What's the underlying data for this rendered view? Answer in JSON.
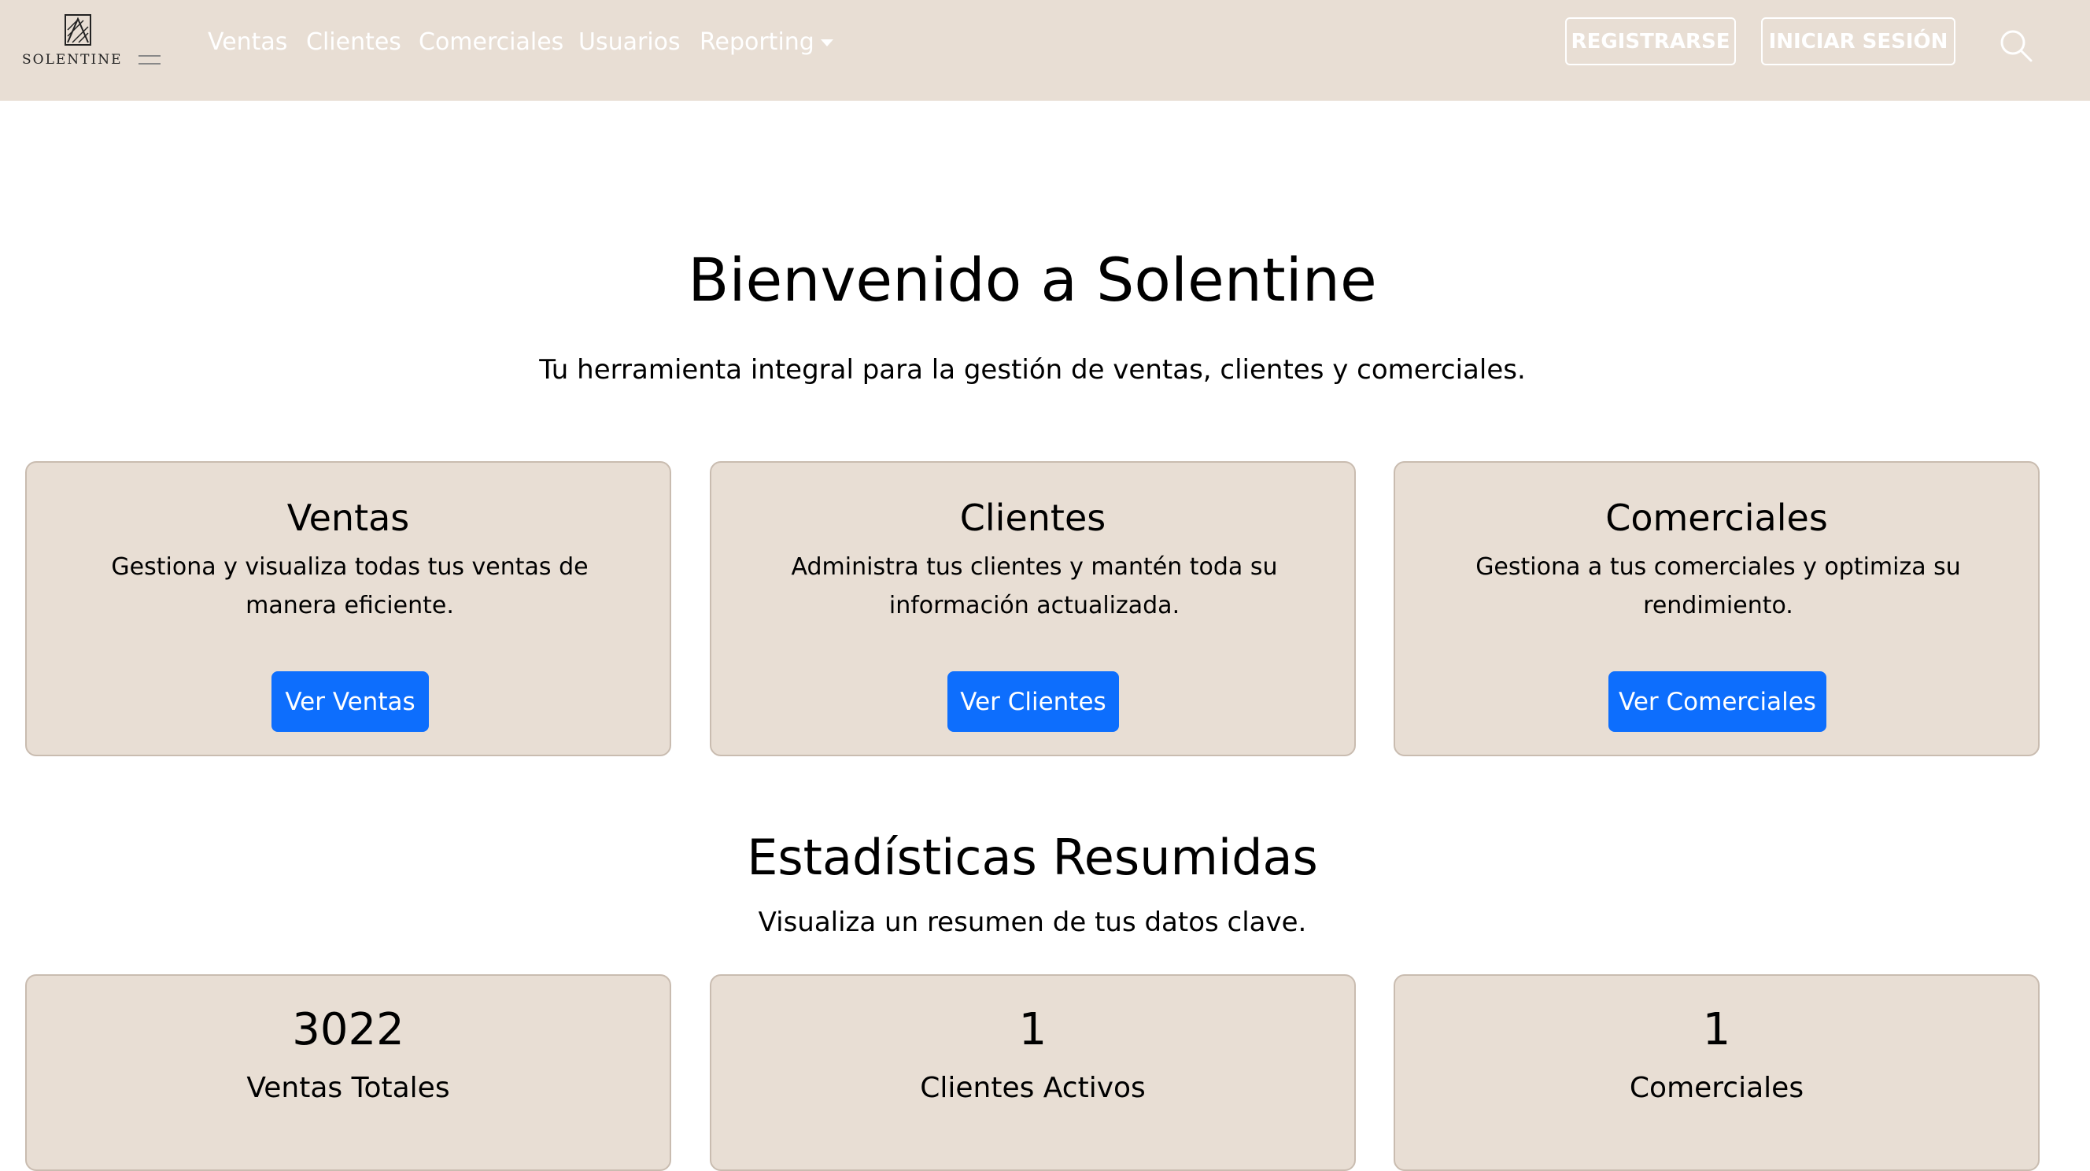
{
  "navbar": {
    "logo_text": "SOLENTINE",
    "links": [
      "Ventas",
      "Clientes",
      "Comerciales",
      "Usuarios",
      "Reporting"
    ],
    "register_label": "REGISTRARSE",
    "login_label": "INICIAR SESIÓN",
    "search_icon": "search-icon"
  },
  "hero": {
    "title": "Bienvenido a Solentine",
    "subtitle": "Tu herramienta integral para la gestión de ventas, clientes y comerciales."
  },
  "cards": [
    {
      "title": "Ventas",
      "description": "Gestiona y visualiza todas tus ventas de manera eficiente.",
      "button": "Ver Ventas"
    },
    {
      "title": "Clientes",
      "description": "Administra tus clientes y mantén toda su información actualizada.",
      "button": "Ver Clientes"
    },
    {
      "title": "Comerciales",
      "description": "Gestiona a tus comerciales y optimiza su rendimiento.",
      "button": "Ver Comerciales"
    }
  ],
  "stats": {
    "title": "Estadísticas Resumidas",
    "subtitle": "Visualiza un resumen de tus datos clave.",
    "items": [
      {
        "value": "3022",
        "label": "Ventas Totales"
      },
      {
        "value": "1",
        "label": "Clientes Activos"
      },
      {
        "value": "1",
        "label": "Comerciales"
      }
    ]
  },
  "colors": {
    "navbar_bg": "#e8ded4",
    "card_bg": "#e8ded4",
    "primary_button": "#0d6efd"
  }
}
